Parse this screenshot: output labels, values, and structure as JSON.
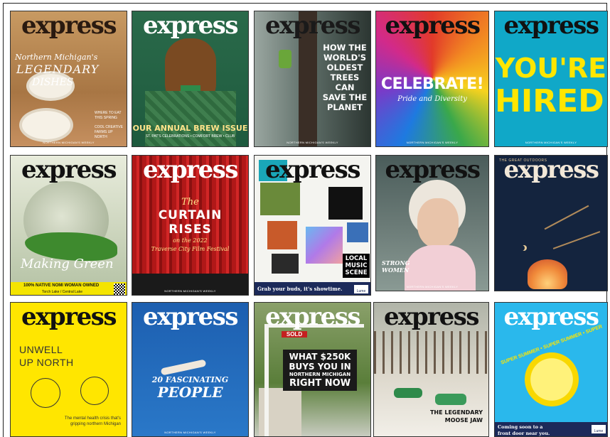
{
  "brand": {
    "title": "express",
    "prefix": "NORTHERN"
  },
  "footer_line": "NORTHERN MICHIGAN'S WEEKLY",
  "covers": [
    {
      "headline_1": "Northern Michigan's",
      "headline_2": "LEGENDARY",
      "headline_3": "DISHES",
      "side_1": "WHERE TO EAT THIS SPRING",
      "side_2": "COOL CREATIVE FARMS UP NORTH"
    },
    {
      "headline": "OUR ANNUAL BREW ISSUE",
      "sub": "ST. PAT'S CELEBRATIONS • COMFORT BREW • CLUB"
    },
    {
      "headline_1": "HOW THE",
      "headline_2": "WORLD'S",
      "headline_3": "OLDEST",
      "headline_4": "TREES CAN",
      "headline_5": "SAVE THE",
      "headline_6": "PLANET"
    },
    {
      "headline": "CELEBRATE!",
      "sub": "Pride and Diversity"
    },
    {
      "headline_1": "YOU'RE",
      "headline_2": "HIRED!"
    },
    {
      "headline_1": "Making Green",
      "sub": "100% NATIVE NOMI WOMAN OWNED",
      "sub_2": "Torch Lake / Central Lake"
    },
    {
      "kicker": "The",
      "headline_1": "CURTAIN",
      "headline_2": "RISES",
      "sub_1": "on the 2022",
      "sub_2": "Traverse City Film Festival"
    },
    {
      "headline_1": "LOCAL",
      "headline_2": "MUSIC",
      "headline_3": "SCENE",
      "ad": "Grab your buds, it's showtime.",
      "ad_brand": "Lume"
    },
    {
      "headline_1": "STRONG",
      "headline_2": "WOMEN"
    },
    {
      "kicker": "THE GREAT OUTDOORS"
    },
    {
      "headline_1": "UNWELL",
      "headline_2": "UP NORTH",
      "sub_1": "The mental health crisis that's",
      "sub_2": "gripping northern Michigan"
    },
    {
      "headline_1": "20 FASCINATING",
      "headline_2": "PEOPLE"
    },
    {
      "sign": "SOLD",
      "headline_1": "WHAT $250K",
      "headline_2": "BUYS YOU IN",
      "headline_3": "NORTHERN MICHIGAN",
      "headline_4": "RIGHT NOW"
    },
    {
      "headline_1": "THE LEGENDARY",
      "headline_2": "MOOSE JAW"
    },
    {
      "ring": "SUPER SUMMER • SUPER SUMMER • SUPER",
      "ad_1": "Coming soon to a",
      "ad_2": "front door near you.",
      "ad_brand": "Lume"
    }
  ],
  "colors": {
    "express_red": "#b0222a",
    "hired_yellow": "#ffe600",
    "hired_teal": "#10a8c8"
  }
}
